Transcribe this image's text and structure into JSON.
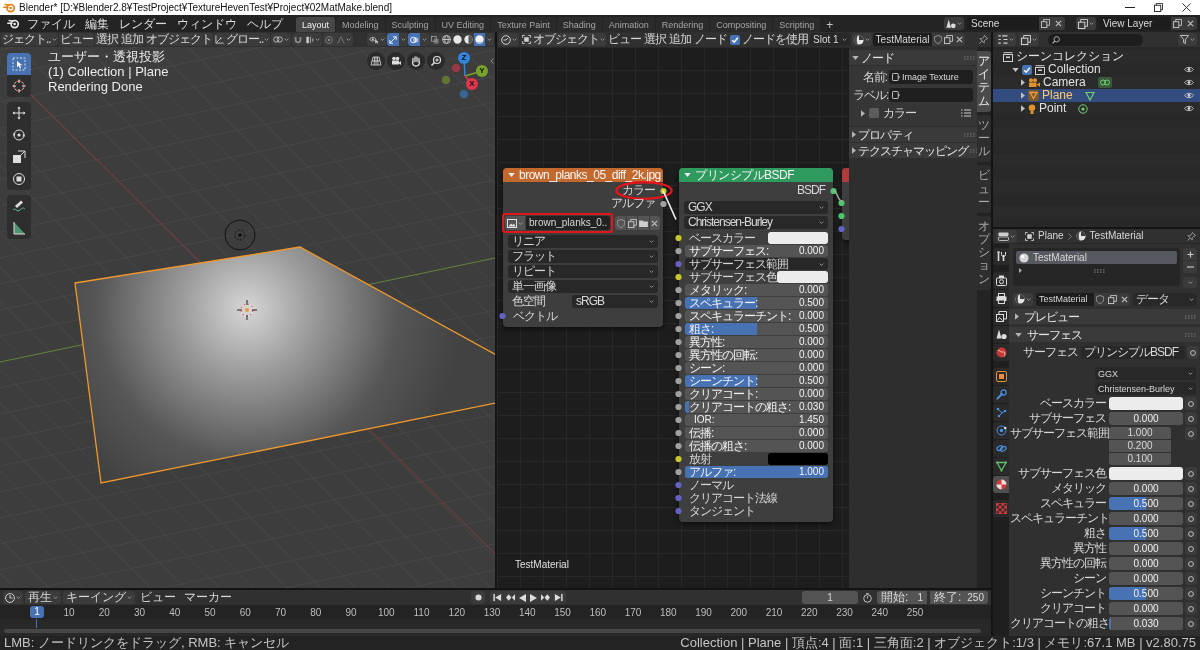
{
  "window": {
    "title": "Blender* [D:¥Blender2.8¥TestProject¥TextureHevenTest¥Project¥02MatMake.blend]"
  },
  "top_bar": {
    "menus": [
      "ファイル",
      "編集",
      "レンダー",
      "ウィンドウ",
      "ヘルプ"
    ],
    "workspace_tabs": [
      {
        "label": "Layout",
        "selected": true
      },
      {
        "label": "Modeling",
        "selected": false
      },
      {
        "label": "Sculpting",
        "selected": false
      },
      {
        "label": "UV Editing",
        "selected": false
      },
      {
        "label": "Texture Paint",
        "selected": false
      },
      {
        "label": "Shading",
        "selected": false
      },
      {
        "label": "Animation",
        "selected": false
      },
      {
        "label": "Rendering",
        "selected": false
      },
      {
        "label": "Compositing",
        "selected": false
      },
      {
        "label": "Scripting",
        "selected": false
      }
    ],
    "add_workspace": "+",
    "scene": "Scene",
    "view_layer": "View Layer"
  },
  "viewport": {
    "mode": "ジェクト..",
    "menus": [
      "ビュー",
      "選択",
      "追加",
      "オブジェクト"
    ],
    "orientation": "グロー..",
    "snapping": {
      "on": false
    },
    "proportional_editing": {
      "on": false
    },
    "gizmos": {
      "on": true
    },
    "overlays": {
      "on": true
    },
    "xray": {
      "on": false
    },
    "shading": [
      {
        "kind": "wireframe",
        "selected": false
      },
      {
        "kind": "solid",
        "selected": false
      },
      {
        "kind": "material",
        "selected": false
      },
      {
        "kind": "rendered",
        "selected": true
      }
    ],
    "tools": [
      [
        {
          "kind": "select",
          "selected": true
        },
        {
          "kind": "cursor",
          "selected": false
        }
      ],
      [
        {
          "kind": "move",
          "selected": false
        },
        {
          "kind": "rotate",
          "selected": false
        },
        {
          "kind": "scale",
          "selected": false
        },
        {
          "kind": "transform",
          "selected": false
        }
      ],
      [
        {
          "kind": "annotate",
          "selected": false
        },
        {
          "kind": "measure",
          "selected": false
        }
      ]
    ],
    "info": [
      "ユーザー・透視投影",
      "(1) Collection | Plane",
      "Rendering Done"
    ],
    "gizmo_axes": [
      {
        "label": "Z",
        "color": "#2f86e0"
      },
      {
        "label": "Y",
        "color": "#78a22a"
      },
      {
        "label": "X",
        "color": "#e0354f"
      }
    ]
  },
  "node_editor": {
    "mode": "オブジェクト",
    "menus": [
      "ビュー",
      "選択",
      "追加",
      "ノード"
    ],
    "use_nodes": {
      "label": "ノードを使用",
      "checked": true
    },
    "slot": "Slot 1",
    "material": "TestMaterial",
    "nodes": [
      {
        "kind": "image_texture",
        "title": "brown_planks_05_diff_2k.jpg",
        "color": "#c4692e",
        "outputs": [
          {
            "label": "カラー",
            "socket": {
              "color": "#c7c729"
            },
            "dragging": true,
            "highlighted": true
          },
          {
            "label": "アルファ",
            "socket": {
              "color": "#a1a1a1"
            },
            "dragging": false,
            "highlighted": false
          }
        ],
        "image": {
          "name": "brown_planks_0..",
          "highlighted": true
        },
        "settings": [
          {
            "value": "リニア"
          },
          {
            "value": "フラット"
          },
          {
            "value": "リピート"
          },
          {
            "value": "単一画像"
          },
          {
            "label": "色空間",
            "value": "sRGB"
          }
        ],
        "inputs": [
          {
            "kind": "socket",
            "label": "ベクトル",
            "socket": {
              "color": "#6363c7"
            }
          }
        ]
      },
      {
        "kind": "principled",
        "title": "プリンシプルBSDF",
        "color": "#2f9a5d",
        "outputs": [
          {
            "label": "BSDF",
            "socket": {
              "color": "#4fc36f"
            },
            "connected": true,
            "highlighted": false
          }
        ],
        "settings": [
          {
            "value": "GGX"
          },
          {
            "value": "Christensen-Burley"
          }
        ],
        "inputs": [
          {
            "kind": "color",
            "label": "ベースカラー",
            "socket": {
              "color": "#c7c729"
            },
            "color": "#ececec"
          },
          {
            "kind": "slider",
            "label": "サブサーフェス:",
            "value": "0.000",
            "socket": {
              "color": "#a1a1a1"
            }
          },
          {
            "kind": "menu",
            "label": "サブサーフェス範囲",
            "socket": {
              "color": "#6363c7"
            }
          },
          {
            "kind": "color",
            "label": "サブサーフェス色",
            "socket": {
              "color": "#c7c729"
            },
            "color": "#ececec"
          },
          {
            "kind": "slider",
            "label": "メタリック:",
            "value": "0.000",
            "socket": {
              "color": "#a1a1a1"
            }
          },
          {
            "kind": "slider",
            "label": "スペキュラー:",
            "value": "0.500",
            "level": 0.5,
            "socket": {
              "color": "#a1a1a1"
            }
          },
          {
            "kind": "slider",
            "label": "スペキュラーチント:",
            "value": "0.000",
            "socket": {
              "color": "#a1a1a1"
            }
          },
          {
            "kind": "slider",
            "label": "粗さ:",
            "value": "0.500",
            "level": 0.5,
            "socket": {
              "color": "#a1a1a1"
            }
          },
          {
            "kind": "slider",
            "label": "異方性:",
            "value": "0.000",
            "socket": {
              "color": "#a1a1a1"
            }
          },
          {
            "kind": "slider",
            "label": "異方性の回転:",
            "value": "0.000",
            "socket": {
              "color": "#a1a1a1"
            }
          },
          {
            "kind": "slider",
            "label": "シーン:",
            "value": "0.000",
            "socket": {
              "color": "#a1a1a1"
            }
          },
          {
            "kind": "slider",
            "label": "シーンチント:",
            "value": "0.500",
            "level": 0.5,
            "socket": {
              "color": "#a1a1a1"
            }
          },
          {
            "kind": "slider",
            "label": "クリアコート:",
            "value": "0.000",
            "socket": {
              "color": "#a1a1a1"
            }
          },
          {
            "kind": "slider",
            "label": "クリアコートの粗さ:",
            "value": "0.030",
            "level": 0.03,
            "socket": {
              "color": "#a1a1a1"
            }
          },
          {
            "kind": "number",
            "label": "IOR:",
            "value": "1.450",
            "socket": {
              "color": "#a1a1a1"
            }
          },
          {
            "kind": "slider",
            "label": "伝播:",
            "value": "0.000",
            "socket": {
              "color": "#a1a1a1"
            }
          },
          {
            "kind": "slider",
            "label": "伝播の粗さ:",
            "value": "0.000",
            "socket": {
              "color": "#a1a1a1"
            }
          },
          {
            "kind": "color",
            "label": "放射",
            "socket": {
              "color": "#c7c729"
            },
            "color": "#000000"
          },
          {
            "kind": "slider",
            "label": "アルファ:",
            "value": "1.000",
            "level": 1,
            "socket": {
              "color": "#a1a1a1"
            }
          },
          {
            "kind": "socket",
            "label": "ノーマル",
            "socket": {
              "color": "#6363c7"
            }
          },
          {
            "kind": "socket",
            "label": "クリアコート法線",
            "socket": {
              "color": "#6363c7"
            }
          },
          {
            "kind": "socket",
            "label": "タンジェント",
            "socket": {
              "color": "#6363c7"
            }
          }
        ]
      },
      {
        "kind": "output",
        "color": "#b23a3a",
        "inputs": [
          {
            "kind": "socket",
            "socket": {
              "color": "#4fc36f"
            }
          },
          {
            "kind": "socket",
            "socket": {
              "color": "#4fc36f"
            }
          },
          {
            "kind": "socket",
            "socket": {
              "color": "#6363c7"
            }
          }
        ]
      }
    ],
    "material_name": "TestMaterial",
    "sidebar": {
      "tabs": [
        {
          "label": "アイテム",
          "selected": true
        },
        {
          "label": "ツール",
          "selected": false
        },
        {
          "label": "ビュー",
          "selected": false
        },
        {
          "label": "オプション",
          "selected": false
        }
      ],
      "panels": [
        {
          "title": "ノード",
          "expanded": true,
          "fields": [
            {
              "label": "名前:",
              "value": "Image Texture"
            },
            {
              "label": "ラベル:"
            }
          ],
          "subpanels": [
            {
              "title": "カラー",
              "expanded": false,
              "checked": false
            }
          ]
        },
        {
          "title": "プロパティ",
          "expanded": false
        },
        {
          "title": "テクスチャマッピング",
          "expanded": false
        }
      ]
    }
  },
  "outliner": {
    "tree": [
      {
        "label": "シーンコレクション",
        "kind": "scene_collection",
        "children": [
          {
            "label": "Collection",
            "kind": "collection",
            "expanded": true,
            "checked": true,
            "selected": false,
            "visible": true,
            "children": [
              {
                "label": "Camera",
                "kind": "camera",
                "expanded": false,
                "selected": false,
                "visible": true
              },
              {
                "label": "Plane",
                "kind": "mesh",
                "expanded": false,
                "selected": true,
                "visible": true
              },
              {
                "label": "Point",
                "kind": "light",
                "expanded": false,
                "selected": false,
                "visible": true
              }
            ]
          }
        ]
      }
    ]
  },
  "properties": {
    "object": "Plane",
    "material": "TestMaterial",
    "tabs": [
      [
        {
          "kind": "tool",
          "selected": false
        }
      ],
      [
        {
          "kind": "render",
          "selected": false
        },
        {
          "kind": "output",
          "selected": false
        },
        {
          "kind": "view_layer",
          "selected": false
        },
        {
          "kind": "scene",
          "selected": false
        },
        {
          "kind": "world",
          "selected": false
        }
      ],
      [
        {
          "kind": "object",
          "selected": false
        },
        {
          "kind": "modifiers",
          "selected": false
        },
        {
          "kind": "particles",
          "selected": false
        },
        {
          "kind": "physics",
          "selected": false
        },
        {
          "kind": "constraints",
          "selected": false
        },
        {
          "kind": "data",
          "selected": false
        },
        {
          "kind": "material",
          "selected": true
        }
      ],
      [
        {
          "kind": "texture",
          "selected": false
        }
      ]
    ],
    "slots": [
      {
        "label": "TestMaterial",
        "selected": true
      }
    ],
    "material_field": "TestMaterial",
    "link": "データ",
    "panels": [
      {
        "title": "プレビュー",
        "expanded": false
      },
      {
        "title": "サーフェス",
        "expanded": true,
        "rows": [
          {
            "kind": "shader",
            "label": "サーフェス",
            "value": "プリンシプルBSDF"
          },
          {
            "kind": "menu",
            "value": "GGX"
          },
          {
            "kind": "menu",
            "value": "Christensen-Burley"
          },
          {
            "kind": "color",
            "label": "ベースカラー",
            "color": "#ececec"
          },
          {
            "kind": "slider",
            "label": "サブサーフェス",
            "value": "0.000"
          },
          {
            "kind": "vector",
            "label": "サブサーフェス範囲",
            "values": [
              "1.000",
              "0.200",
              "0.100"
            ]
          },
          {
            "kind": "color",
            "label": "サブサーフェス色",
            "color": "#ececec"
          },
          {
            "kind": "slider",
            "label": "メタリック",
            "value": "0.000"
          },
          {
            "kind": "slider",
            "label": "スペキュラー",
            "value": "0.500",
            "level": 0.5
          },
          {
            "kind": "slider",
            "label": "スペキュラーチント",
            "value": "0.000"
          },
          {
            "kind": "slider",
            "label": "粗さ",
            "value": "0.500",
            "level": 0.5
          },
          {
            "kind": "slider",
            "label": "異方性",
            "value": "0.000"
          },
          {
            "kind": "slider",
            "label": "異方性の回転",
            "value": "0.000"
          },
          {
            "kind": "slider",
            "label": "シーン",
            "value": "0.000"
          },
          {
            "kind": "slider",
            "label": "シーンチント",
            "value": "0.500",
            "level": 0.5
          },
          {
            "kind": "slider",
            "label": "クリアコート",
            "value": "0.000"
          },
          {
            "kind": "slider",
            "label": "クリアコートの粗さ",
            "value": "0.030",
            "level": 0.03
          }
        ]
      }
    ]
  },
  "timeline": {
    "menus": [
      {
        "label": "再生",
        "dropdown": true
      },
      {
        "label": "キーイング",
        "dropdown": true
      },
      {
        "label": "ビュー",
        "dropdown": false
      },
      {
        "label": "マーカー",
        "dropdown": false
      }
    ],
    "current_frame": "1",
    "start": {
      "label": "開始:",
      "value": "1"
    },
    "end": {
      "label": "終了:",
      "value": "250"
    },
    "playhead": "1",
    "ticks": [
      "10",
      "20",
      "30",
      "40",
      "50",
      "60",
      "70",
      "80",
      "90",
      "100",
      "110",
      "120",
      "130",
      "140",
      "150",
      "160",
      "170",
      "180",
      "190",
      "200",
      "210",
      "220",
      "230",
      "240",
      "250"
    ]
  },
  "status_bar": {
    "hint": "LMB: ノードリンクをドラッグ, RMB: キャンセル",
    "stats": "Collection | Plane | 頂点:4 | 面:1 | 三角面:2 | オブジェクト:1/3 | メモリ:67.1 MB | v2.80.75"
  }
}
